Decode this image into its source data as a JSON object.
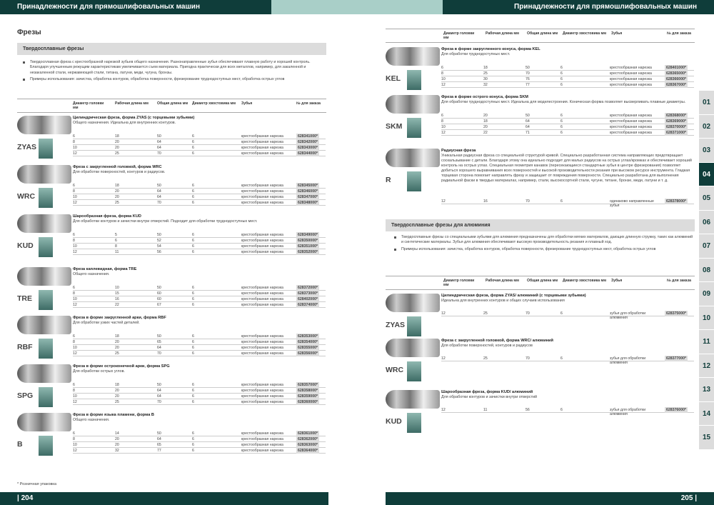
{
  "header": {
    "left": "Принадлежности для прямошлифовальных машин",
    "right": "Принадлежности для прямошлифовальных машин"
  },
  "footer": {
    "left": "| 204",
    "right": "205 |"
  },
  "left_page": {
    "title": "Фрезы",
    "bar": "Твердосплавные фрезы",
    "bullets": [
      "Твердосплавная фреза с крестообразной нарезкой зубьев общего назначения. Разнонаправленные зубья обеспечивают плавную работу и хорошей контроль. Благодаря улучшенным режущим характеристикам увеличивается съем материала. Пригодна практически для всех металлов, например, для закаленной и незакаленной стали, нержавеющей стали, титана, латуни, меди, чугуна, бронзы.",
      "Примеры использования: зачистка, обработка контуров, обработка поверхности, фрезерование труднодоступных мест, обработка острых углов"
    ],
    "headers": [
      "Диаметр головки мм",
      "Рабочая длина мм",
      "Общая длина мм",
      "Диаметр хвостовика мм",
      "Зубья",
      "№ для заказа"
    ],
    "groups": [
      {
        "code": "ZYAS",
        "title": "Цилиндрическая фреза, форма ZYAS (с торцевыми зубьями)",
        "desc": "Общего назначения. Идеальна для внутренних контуров.",
        "rows": [
          [
            "6",
            "18",
            "50",
            "6",
            "крестообразная нарезка",
            "628341000*"
          ],
          [
            "8",
            "20",
            "64",
            "6",
            "крестообразная нарезка",
            "628342000*"
          ],
          [
            "10",
            "20",
            "64",
            "6",
            "крестообразная нарезка",
            "628343000*"
          ],
          [
            "12",
            "25",
            "70",
            "6",
            "крестообразная нарезка",
            "628344000*"
          ]
        ]
      },
      {
        "code": "WRC",
        "title": "Фреза с закругленной головкой, форма WRC",
        "desc": "Для обработки поверхностей, контуров и радиусов.",
        "rows": [
          [
            "6",
            "18",
            "50",
            "6",
            "крестообразная нарезка",
            "628345000*"
          ],
          [
            "8",
            "20",
            "64",
            "6",
            "крестообразная нарезка",
            "628346000*"
          ],
          [
            "10",
            "20",
            "64",
            "6",
            "крестообразная нарезка",
            "628347000*"
          ],
          [
            "12",
            "25",
            "70",
            "6",
            "крестообразная нарезка",
            "628348000*"
          ]
        ]
      },
      {
        "code": "KUD",
        "title": "Шарообразная фреза, форма KUD",
        "desc": "Для обработки контуров и зачистки внутри отверстий. Подходит для обработки труднодоступных мест.",
        "rows": [
          [
            "6",
            "5",
            "50",
            "6",
            "крестообразная нарезка",
            "628349000*"
          ],
          [
            "8",
            "6",
            "52",
            "6",
            "крестообразная нарезка",
            "628350000*"
          ],
          [
            "10",
            "8",
            "54",
            "6",
            "крестообразная нарезка",
            "628351000*"
          ],
          [
            "12",
            "11",
            "56",
            "6",
            "крестообразная нарезка",
            "628352000*"
          ]
        ]
      },
      {
        "code": "TRE",
        "title": "Фреза каплевидная, форма TRE",
        "desc": "Общего назначения.",
        "rows": [
          [
            "6",
            "10",
            "50",
            "6",
            "крестообразная нарезка",
            "628372000*"
          ],
          [
            "8",
            "15",
            "60",
            "6",
            "крестообразная нарезка",
            "628373000*"
          ],
          [
            "10",
            "16",
            "60",
            "6",
            "крестообразная нарезка",
            "628402000*"
          ],
          [
            "12",
            "22",
            "67",
            "6",
            "крестообразная нарезка",
            "628374000*"
          ]
        ]
      },
      {
        "code": "RBF",
        "title": "Фреза в форме закругленной арки, форма RBF",
        "desc": "Для обработки узких частей деталей.",
        "rows": [
          [
            "6",
            "18",
            "50",
            "6",
            "крестообразная нарезка",
            "628353000*"
          ],
          [
            "8",
            "20",
            "65",
            "6",
            "крестообразная нарезка",
            "628354000*"
          ],
          [
            "10",
            "20",
            "64",
            "6",
            "крестообразная нарезка",
            "628355000*"
          ],
          [
            "12",
            "25",
            "70",
            "6",
            "крестообразная нарезка",
            "628356000*"
          ]
        ]
      },
      {
        "code": "SPG",
        "title": "Фреза в форме остроконечной арки, форма SPG",
        "desc": "Для обработки острых углов.",
        "rows": [
          [
            "6",
            "18",
            "50",
            "6",
            "крестообразная нарезка",
            "628357000*"
          ],
          [
            "8",
            "20",
            "64",
            "6",
            "крестообразная нарезка",
            "628358000*"
          ],
          [
            "10",
            "20",
            "64",
            "6",
            "крестообразная нарезка",
            "628359000*"
          ],
          [
            "12",
            "25",
            "70",
            "6",
            "крестообразная нарезка",
            "628360000*"
          ]
        ]
      },
      {
        "code": "B",
        "title": "Фреза в форме языка пламени, форма B",
        "desc": "Общего назначения.",
        "rows": [
          [
            "6",
            "14",
            "50",
            "6",
            "крестообразная нарезка",
            "628361000*"
          ],
          [
            "8",
            "20",
            "64",
            "6",
            "крестообразная нарезка",
            "628362000*"
          ],
          [
            "10",
            "20",
            "65",
            "6",
            "крестообразная нарезка",
            "628363000*"
          ],
          [
            "12",
            "32",
            "77",
            "6",
            "крестообразная нарезка",
            "628364000*"
          ]
        ]
      }
    ],
    "footnote": "* Розничная упаковка"
  },
  "right_page": {
    "headers": [
      "Диаметр головки мм",
      "Рабочая длина мм",
      "Общая длина мм",
      "Диаметр хвостовика мм",
      "Зубья",
      "№ для заказа"
    ],
    "groups": [
      {
        "code": "KEL",
        "title": "Фреза в форме закругленного конуса, форма KEL",
        "desc": "Для обработки труднодоступных мест.",
        "rows": [
          [
            "6",
            "18",
            "50",
            "6",
            "крестообразная нарезка",
            "628401000*"
          ],
          [
            "8",
            "25",
            "70",
            "6",
            "крестообразная нарезка",
            "628365000*"
          ],
          [
            "10",
            "30",
            "76",
            "6",
            "крестообразная нарезка",
            "628366000*"
          ],
          [
            "12",
            "32",
            "77",
            "6",
            "крестообразная нарезка",
            "628367000*"
          ]
        ]
      },
      {
        "code": "SKM",
        "title": "Фреза в форме острого конуса, форма SKM",
        "desc": "Для обработки труднодоступных мест. Идеальна для моделестроения. Коническая форма позволяет высверливать плавные диаметры.",
        "rows": [
          [
            "6",
            "20",
            "50",
            "6",
            "крестообразная нарезка",
            "628368000*"
          ],
          [
            "8",
            "18",
            "64",
            "6",
            "крестообразная нарезка",
            "628369000*"
          ],
          [
            "10",
            "20",
            "64",
            "6",
            "крестообразная нарезка",
            "628370000*"
          ],
          [
            "12",
            "22",
            "71",
            "6",
            "крестообразная нарезка",
            "628371000*"
          ]
        ]
      },
      {
        "code": "R",
        "title": "Радиусная фреза",
        "desc": "Уникальная радиусная фреза со специальной структурой кривой. Специально разработанная система направляющих предотвращает соскальзывание с детали. Благодаря этому она идеально подходит для малых радиусов на острых углах/кромках и обеспечивает хороший контроль на острых углах. Специальная геометрия канавок (пересекающиеся стандартные зубья в центре фрезерования) позволяет добиться хорошего выравнивания всех поверхностей и высокой производительности резания при высоком ресурсе инструмента. Гладкая торцевая сторона помогает направлять фрезу и защищает от повреждения поверхности. Специально разработана для выполнения радиальной фаски в твердых материалах, например, стали, высокосортной стали, чугуне, титане, бронзе, меди, латуни и т. д.",
        "rows": [
          [
            "12",
            "16",
            "70",
            "6",
            "одинаково направленные зубья",
            "628378000*"
          ]
        ]
      }
    ],
    "bar": "Твердосплавные фрезы для алюминия",
    "bullets": [
      "Твердосплавные фрезы со специальными зубьями для алюминия предназначены для обработки мягких материалов, дающих длинную стружку, таких как алюминий и синтетические материалы. Зубья для алюминия обеспечивают высокую производительность резания и плавный ход.",
      "Примеры использования: зачистка, обработка контуров, обработка поверхности, фрезерование труднодоступных мест, обработка острых углов"
    ],
    "alu_groups": [
      {
        "code": "ZYAS",
        "title": "Цилиндрическая фреза, форма ZYAS/ алюминий (с торцевыми зубьями)",
        "desc": "Идеальна для внутренних контуров и общих случаев использования",
        "rows": [
          [
            "12",
            "25",
            "70",
            "6",
            "зубья для обработки алюминия",
            "628375000*"
          ]
        ]
      },
      {
        "code": "WRC",
        "title": "Фреза с закругленной головкой, форма WRC/ алюминий",
        "desc": "Для обработки поверхностей, контуров и радиусов",
        "rows": [
          [
            "12",
            "25",
            "70",
            "6",
            "зубья для обработки алюминия",
            "628377000*"
          ]
        ]
      },
      {
        "code": "KUD",
        "title": "Шарообразная фреза, форма KUD/ алюминий",
        "desc": "Для обработки контуров и зачистки внутри отверстий",
        "rows": [
          [
            "12",
            "11",
            "56",
            "6",
            "зубья для обработки алюминия",
            "628376000*"
          ]
        ]
      }
    ]
  },
  "tabs": [
    "01",
    "02",
    "03",
    "04",
    "05",
    "06",
    "07",
    "08",
    "09",
    "10",
    "11",
    "12",
    "13",
    "14",
    "15"
  ],
  "active_tab": "04"
}
